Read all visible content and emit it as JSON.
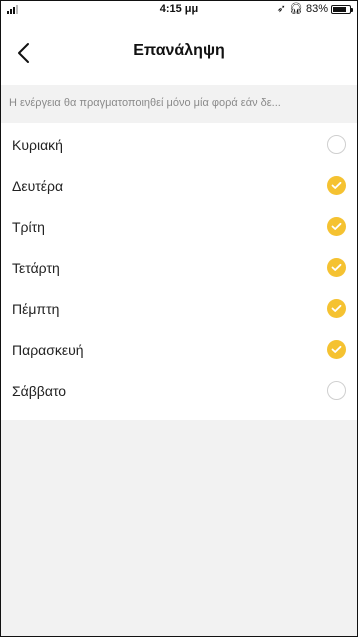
{
  "status_bar": {
    "time": "4:15 μμ",
    "battery": "83%",
    "battery_level": 0.83,
    "icons": [
      "signal-icon",
      "location-icon",
      "headphones-icon",
      "battery-icon"
    ]
  },
  "header": {
    "title": "Επανάληψη",
    "back_icon": "chevron-left-icon"
  },
  "hint": "Η ενέργεια θα πραγματοποιηθεί μόνο μία φορά εάν δε...",
  "days": [
    {
      "label": "Κυριακή",
      "checked": false
    },
    {
      "label": "Δευτέρα",
      "checked": true
    },
    {
      "label": "Τρίτη",
      "checked": true
    },
    {
      "label": "Τετάρτη",
      "checked": true
    },
    {
      "label": "Πέμπτη",
      "checked": true
    },
    {
      "label": "Παρασκευή",
      "checked": true
    },
    {
      "label": "Σάββατο",
      "checked": false
    }
  ],
  "colors": {
    "accent": "#f5c231",
    "background": "#f2f2f2",
    "hint_text": "#8a8a8a"
  }
}
